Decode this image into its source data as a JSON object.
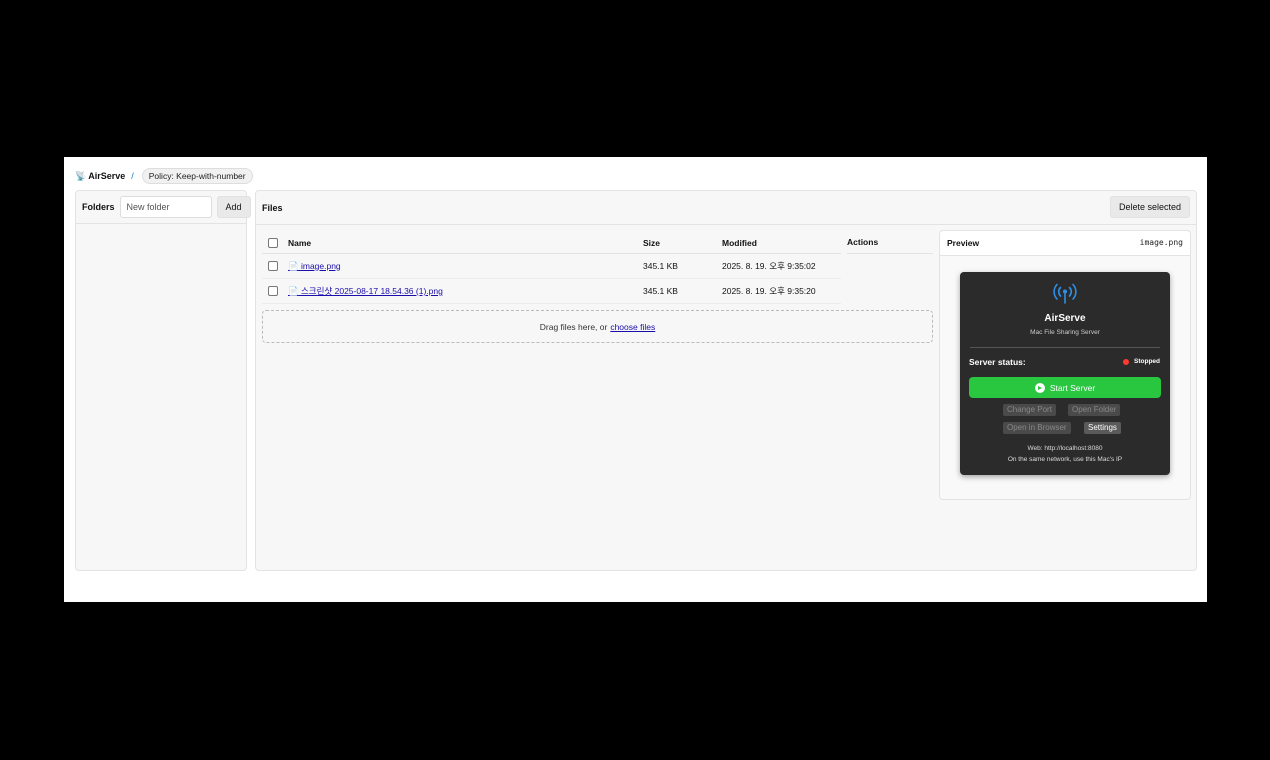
{
  "header": {
    "brand_icon": "📡",
    "brand_name": "AirServe",
    "separator": "/",
    "policy_badge": "Policy: Keep-with-number"
  },
  "folders": {
    "label": "Folders",
    "input_placeholder": "New folder",
    "add_label": "Add"
  },
  "files": {
    "label": "Files",
    "delete_label": "Delete selected",
    "columns": {
      "name": "Name",
      "size": "Size",
      "modified": "Modified",
      "actions": "Actions"
    },
    "rows": [
      {
        "icon": "📄",
        "name": "image.png",
        "size": "345.1 KB",
        "modified": "2025. 8. 19. 오후 9:35:02"
      },
      {
        "icon": "📄",
        "name": "스크린샷 2025-08-17 18.54.36 (1).png",
        "size": "345.1 KB",
        "modified": "2025. 8. 19. 오후 9:35:20"
      }
    ],
    "drop_text": "Drag files here, or",
    "drop_link": "choose files"
  },
  "preview": {
    "title": "Preview",
    "filename": "image.png",
    "app": {
      "icon": "antenna-icon",
      "name": "AirServe",
      "subtitle": "Mac File Sharing Server",
      "status_label": "Server status:",
      "status_value": "Stopped",
      "status_color": "#ff3b30",
      "start_label": "Start Server",
      "start_color": "#29c740",
      "change_port": "Change Port",
      "open_folder": "Open Folder",
      "open_browser": "Open in Browser",
      "settings": "Settings",
      "web_info": "Web: http://localhost:8080",
      "network_info": "On the same network, use this Mac's IP"
    }
  }
}
